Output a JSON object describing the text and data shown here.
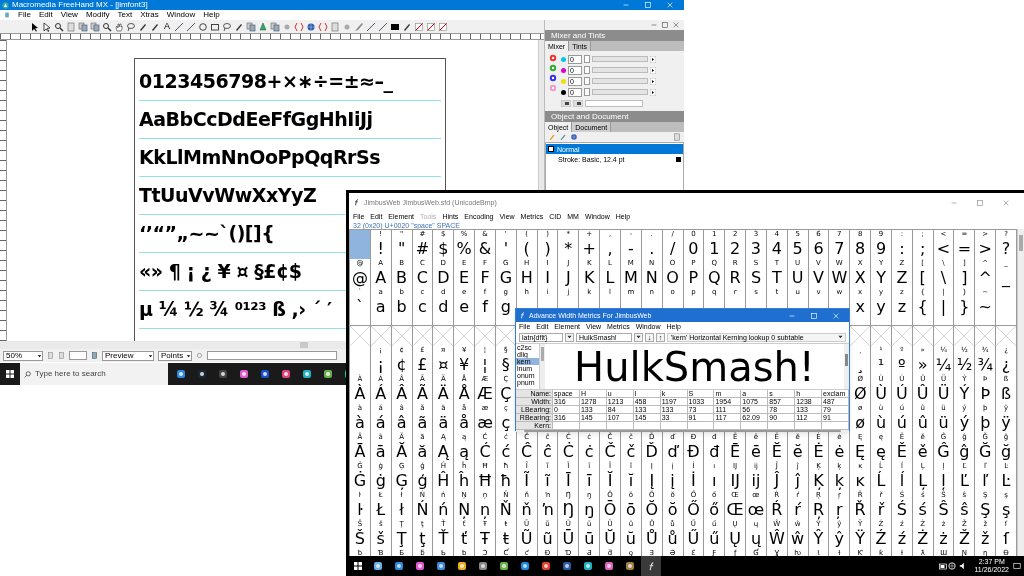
{
  "freehand": {
    "title": "Macromedia FreeHand MX - [jimfont3]",
    "menu": [
      "File",
      "Edit",
      "View",
      "Modify",
      "Text",
      "Xtras",
      "Window",
      "Help"
    ],
    "text_tool": "A",
    "paper_lines": [
      "0123456798+×∗÷=±≈–_",
      "AaBbCcDdEeFfGgHhIiJj",
      "KkLlMmNnOoPpQqRrSs",
      "TtUuVvWwXxYyZ",
      "‘’“”„~~`()[]{",
      "«» ¶ ¡ ¿ ¥ ¤ §£¢$",
      "µ ¼ ½ ¾ ⁰¹²³ ß ,› ´ ′"
    ],
    "mixer": {
      "title": "Mixer and Tints",
      "tabs": [
        {
          "label": "Mixer",
          "selected": true
        },
        {
          "label": "Tints",
          "selected": false
        }
      ],
      "channels": [
        {
          "color": "#00c8e8",
          "value": "0"
        },
        {
          "color": "#e000c8",
          "value": "0"
        },
        {
          "color": "#f0e000",
          "value": "0"
        },
        {
          "color": "#000000",
          "value": "0"
        }
      ]
    },
    "object_panel": {
      "title": "Object and Document",
      "tabs": [
        {
          "label": "Object",
          "selected": true
        },
        {
          "label": "Document",
          "selected": false
        }
      ],
      "items": [
        {
          "label": "Normal",
          "selected": true
        },
        {
          "label": "Stroke: Basic, 12.4 pt",
          "selected": false
        }
      ]
    },
    "status": {
      "zoom": "50%",
      "view": "Preview",
      "units": "Points"
    },
    "taskbar": {
      "search_placeholder": "Type here to search"
    }
  },
  "fontforge": {
    "title": "JimbusWeb JimbusWeb.sfd (UnicodeBmp)",
    "menu": [
      {
        "label": "File",
        "disabled": false
      },
      {
        "label": "Edit",
        "disabled": false
      },
      {
        "label": "Element",
        "disabled": false
      },
      {
        "label": "Tools",
        "disabled": true
      },
      {
        "label": "Hints",
        "disabled": false
      },
      {
        "label": "Encoding",
        "disabled": false
      },
      {
        "label": "View",
        "disabled": false
      },
      {
        "label": "Metrics",
        "disabled": false
      },
      {
        "label": "CID",
        "disabled": false
      },
      {
        "label": "MM",
        "disabled": false
      },
      {
        "label": "Window",
        "disabled": false
      },
      {
        "label": "Help",
        "disabled": false
      }
    ],
    "info": "32 (0x20) U+0020 \"space\" SPACE",
    "rows": [
      {
        "cells": [
          {
            "selected": true
          },
          {
            "label": "!",
            "glyph": "!",
            "selected": false
          },
          {
            "label": "\"",
            "glyph": "\"",
            "selected": false
          },
          {
            "label": "#",
            "glyph": "#",
            "selected": false
          },
          {
            "label": "$",
            "glyph": "$",
            "selected": false
          },
          {
            "label": "%",
            "glyph": "%",
            "selected": false
          },
          {
            "label": "&",
            "glyph": "&",
            "selected": false
          },
          {
            "label": "'",
            "glyph": "'",
            "selected": false
          },
          {
            "label": "(",
            "glyph": "(",
            "selected": false
          },
          {
            "label": ")",
            "glyph": ")",
            "selected": false
          },
          {
            "label": "*",
            "glyph": "*",
            "selected": false
          },
          {
            "label": "+",
            "glyph": "+",
            "selected": false
          },
          {
            "label": ",",
            "glyph": ",",
            "selected": false
          },
          {
            "label": "-",
            "glyph": "-",
            "selected": false
          },
          {
            "label": ".",
            "glyph": ".",
            "selected": false
          },
          {
            "label": "/",
            "glyph": "/",
            "selected": false
          },
          {
            "label": "0",
            "glyph": "0",
            "selected": false
          },
          {
            "label": "1",
            "glyph": "1",
            "selected": false
          },
          {
            "label": "2",
            "glyph": "2",
            "selected": false
          },
          {
            "label": "3",
            "glyph": "3",
            "selected": false
          },
          {
            "label": "4",
            "glyph": "4",
            "selected": false
          },
          {
            "label": "5",
            "glyph": "5",
            "selected": false
          },
          {
            "label": "6",
            "glyph": "6",
            "selected": false
          },
          {
            "label": "7",
            "glyph": "7",
            "selected": false
          },
          {
            "label": "8",
            "glyph": "8",
            "selected": false
          },
          {
            "label": "9",
            "glyph": "9",
            "selected": false
          },
          {
            "label": ":",
            "glyph": ":",
            "selected": false
          },
          {
            "label": ";",
            "glyph": ";",
            "selected": false
          },
          {
            "label": "<",
            "glyph": "<",
            "selected": false
          },
          {
            "label": "=",
            "glyph": "=",
            "selected": false
          },
          {
            "label": ">",
            "glyph": ">",
            "selected": false
          },
          {
            "label": "?",
            "glyph": "?",
            "selected": false
          }
        ]
      },
      {
        "cells": [
          {
            "label": "@",
            "glyph": "@",
            "selected": false
          },
          {
            "label": "A",
            "glyph": "A",
            "selected": false
          },
          {
            "label": "B",
            "glyph": "B",
            "selected": false
          },
          {
            "label": "C",
            "glyph": "C",
            "selected": false
          },
          {
            "label": "D",
            "glyph": "D",
            "selected": false
          },
          {
            "label": "E",
            "glyph": "E",
            "selected": false
          },
          {
            "label": "F",
            "glyph": "F",
            "selected": false
          },
          {
            "label": "G",
            "glyph": "G",
            "selected": false
          },
          {
            "label": "H",
            "glyph": "H",
            "selected": false
          },
          {
            "label": "I",
            "glyph": "I",
            "selected": false
          },
          {
            "label": "J",
            "glyph": "J",
            "selected": false
          },
          {
            "label": "K",
            "glyph": "K",
            "selected": false
          },
          {
            "label": "L",
            "glyph": "L",
            "selected": false
          },
          {
            "label": "M",
            "glyph": "M",
            "selected": false
          },
          {
            "label": "N",
            "glyph": "N",
            "selected": false
          },
          {
            "label": "O",
            "glyph": "O",
            "selected": false
          },
          {
            "label": "P",
            "glyph": "P",
            "selected": false
          },
          {
            "label": "Q",
            "glyph": "Q",
            "selected": false
          },
          {
            "label": "R",
            "glyph": "R",
            "selected": false
          },
          {
            "label": "S",
            "glyph": "S",
            "selected": false
          },
          {
            "label": "T",
            "glyph": "T",
            "selected": false
          },
          {
            "label": "U",
            "glyph": "U",
            "selected": false
          },
          {
            "label": "V",
            "glyph": "V",
            "selected": false
          },
          {
            "label": "W",
            "glyph": "W",
            "selected": false
          },
          {
            "label": "X",
            "glyph": "X",
            "selected": false
          },
          {
            "label": "Y",
            "glyph": "Y",
            "selected": false
          },
          {
            "label": "Z",
            "glyph": "Z",
            "selected": false
          },
          {
            "label": "[",
            "glyph": "[",
            "selected": false
          },
          {
            "label": "\\",
            "glyph": "\\",
            "selected": false
          },
          {
            "label": "]",
            "glyph": "]",
            "selected": false
          },
          {
            "label": "^",
            "glyph": "^",
            "selected": false
          },
          {
            "label": "_",
            "glyph": "_",
            "selected": false
          }
        ]
      },
      {
        "cells": [
          {
            "label": "`",
            "glyph": "`",
            "selected": false
          },
          {
            "label": "a",
            "glyph": "a",
            "selected": false
          },
          {
            "label": "b",
            "glyph": "b",
            "selected": false
          },
          {
            "label": "c",
            "glyph": "c",
            "selected": false
          },
          {
            "label": "d",
            "glyph": "d",
            "selected": false
          },
          {
            "label": "e",
            "glyph": "e",
            "selected": false
          },
          {
            "label": "f",
            "glyph": "f",
            "selected": false
          },
          {
            "label": "g",
            "glyph": "g",
            "selected": false
          },
          {
            "label": "h",
            "selected": false
          },
          {
            "label": "i",
            "selected": false
          },
          {
            "label": "j",
            "selected": false
          },
          {
            "label": "k",
            "selected": false
          },
          {
            "label": "l",
            "selected": false
          },
          {
            "label": "m",
            "selected": false
          },
          {
            "label": "n",
            "selected": false
          },
          {
            "label": "o",
            "selected": false
          },
          {
            "label": "p",
            "selected": false
          },
          {
            "label": "q",
            "selected": false
          },
          {
            "label": "r",
            "selected": false
          },
          {
            "label": "s",
            "selected": false
          },
          {
            "label": "t",
            "selected": false
          },
          {
            "label": "u",
            "selected": false
          },
          {
            "label": "v",
            "selected": false
          },
          {
            "label": "w",
            "selected": false
          },
          {
            "label": "x",
            "glyph": "x",
            "selected": false
          },
          {
            "label": "y",
            "glyph": "y",
            "selected": false
          },
          {
            "label": "z",
            "glyph": "z",
            "selected": false
          },
          {
            "label": "{",
            "glyph": "{",
            "selected": false
          },
          {
            "label": "|",
            "glyph": "|",
            "selected": false
          },
          {
            "label": "}",
            "glyph": "}",
            "selected": false
          },
          {
            "label": "~",
            "glyph": "~",
            "selected": false
          },
          {
            "selected": false
          }
        ]
      },
      {
        "kind": "empty",
        "cells": [
          {
            "selected": false
          },
          {
            "selected": false
          },
          {
            "selected": false
          },
          {
            "selected": false
          },
          {
            "selected": false
          },
          {
            "selected": false
          },
          {
            "selected": false
          },
          {
            "selected": false
          }
        ],
        "right_cells": [
          {
            "selected": false
          },
          {
            "selected": false
          },
          {
            "selected": false
          },
          {
            "selected": false
          },
          {
            "selected": false
          },
          {
            "selected": false
          },
          {
            "selected": false
          },
          {
            "selected": false
          }
        ]
      },
      {
        "cells": [
          {
            "selected": false
          },
          {
            "label": "¡",
            "glyph": "¡",
            "selected": false
          },
          {
            "label": "¢",
            "glyph": "¢",
            "selected": false
          },
          {
            "label": "£",
            "glyph": "£",
            "selected": false
          },
          {
            "label": "¤",
            "glyph": "¤",
            "selected": false
          },
          {
            "label": "¥",
            "glyph": "¥",
            "selected": false
          },
          {
            "label": "¦",
            "glyph": "¦",
            "selected": false
          },
          {
            "label": "§",
            "glyph": "§",
            "selected": false
          }
        ],
        "right_cells": [
          {
            "label": "¸",
            "glyph": "¸",
            "selected": false
          },
          {
            "label": "¹",
            "glyph": "¹",
            "selected": false
          },
          {
            "label": "º",
            "glyph": "º",
            "selected": false
          },
          {
            "label": "»",
            "glyph": "»",
            "selected": false
          },
          {
            "label": "¼",
            "glyph": "¼",
            "selected": false
          },
          {
            "label": "½",
            "glyph": "½",
            "selected": false
          },
          {
            "label": "¾",
            "glyph": "¾",
            "selected": false
          },
          {
            "label": "¿",
            "glyph": "¿",
            "selected": false
          }
        ]
      },
      {
        "cells": [
          {
            "label": "À",
            "glyph": "À",
            "selected": false
          },
          {
            "label": "Á",
            "glyph": "Á",
            "selected": false
          },
          {
            "label": "Â",
            "glyph": "Â",
            "selected": false
          },
          {
            "label": "Ã",
            "glyph": "Ã",
            "selected": false
          },
          {
            "label": "Ä",
            "glyph": "Ä",
            "selected": false
          },
          {
            "label": "Å",
            "glyph": "Å",
            "selected": false
          },
          {
            "label": "Æ",
            "glyph": "Æ",
            "selected": false
          },
          {
            "label": "Ç",
            "glyph": "Ç",
            "selected": false
          }
        ],
        "right_cells": [
          {
            "label": "Ø",
            "glyph": "Ø",
            "selected": false
          },
          {
            "label": "Ù",
            "glyph": "Ù",
            "selected": false
          },
          {
            "label": "Ú",
            "glyph": "Ú",
            "selected": false
          },
          {
            "label": "Û",
            "glyph": "Û",
            "selected": false
          },
          {
            "label": "Ü",
            "glyph": "Ü",
            "selected": false
          },
          {
            "label": "Ý",
            "glyph": "Ý",
            "selected": false
          },
          {
            "label": "Þ",
            "glyph": "Þ",
            "selected": false
          },
          {
            "label": "ß",
            "glyph": "ß",
            "selected": false
          }
        ]
      },
      {
        "cells": [
          {
            "label": "à",
            "glyph": "à",
            "selected": false
          },
          {
            "label": "á",
            "glyph": "á",
            "selected": false
          },
          {
            "label": "â",
            "glyph": "â",
            "selected": false
          },
          {
            "label": "ã",
            "glyph": "ã",
            "selected": false
          },
          {
            "label": "ä",
            "glyph": "ä",
            "selected": false
          },
          {
            "label": "å",
            "glyph": "å",
            "selected": false
          },
          {
            "label": "æ",
            "glyph": "æ",
            "selected": false
          },
          {
            "label": "ç",
            "glyph": "ç",
            "selected": false
          }
        ],
        "right_cells": [
          {
            "label": "ø",
            "glyph": "ø",
            "selected": false
          },
          {
            "label": "ù",
            "glyph": "ù",
            "selected": false
          },
          {
            "label": "ú",
            "glyph": "ú",
            "selected": false
          },
          {
            "label": "û",
            "glyph": "û",
            "selected": false
          },
          {
            "label": "ü",
            "glyph": "ü",
            "selected": false
          },
          {
            "label": "ý",
            "glyph": "ý",
            "selected": false
          },
          {
            "label": "þ",
            "glyph": "þ",
            "selected": false
          },
          {
            "label": "ÿ",
            "glyph": "ÿ",
            "selected": false
          }
        ]
      },
      {
        "cells": [
          {
            "label": "Ā",
            "glyph": "Ā",
            "selected": false
          },
          {
            "label": "ā",
            "glyph": "ā",
            "selected": false
          },
          {
            "label": "Ă",
            "glyph": "Ă",
            "selected": false
          },
          {
            "label": "ă",
            "glyph": "ă",
            "selected": false
          },
          {
            "label": "Ą",
            "glyph": "Ą",
            "selected": false
          },
          {
            "label": "ą",
            "glyph": "ą",
            "selected": false
          },
          {
            "label": "Ć",
            "glyph": "Ć",
            "selected": false
          },
          {
            "label": "ć",
            "glyph": "ć",
            "selected": false
          },
          {
            "label": "Ĉ",
            "glyph": "Ĉ",
            "selected": false
          },
          {
            "label": "ĉ",
            "glyph": "ĉ",
            "selected": false
          },
          {
            "label": "Ċ",
            "glyph": "Ċ",
            "selected": false
          },
          {
            "label": "ċ",
            "glyph": "ċ",
            "selected": false
          },
          {
            "label": "Č",
            "glyph": "Č",
            "selected": false
          },
          {
            "label": "č",
            "glyph": "č",
            "selected": false
          },
          {
            "label": "Ď",
            "glyph": "Ď",
            "selected": false
          },
          {
            "label": "ď",
            "glyph": "ď",
            "selected": false
          },
          {
            "label": "Đ",
            "glyph": "Đ",
            "selected": false
          },
          {
            "label": "đ",
            "glyph": "đ",
            "selected": false
          },
          {
            "label": "Ē",
            "glyph": "Ē",
            "selected": false
          },
          {
            "label": "ē",
            "glyph": "ē",
            "selected": false
          },
          {
            "label": "Ĕ",
            "glyph": "Ĕ",
            "selected": false
          },
          {
            "label": "ĕ",
            "glyph": "ĕ",
            "selected": false
          },
          {
            "label": "Ė",
            "glyph": "Ė",
            "selected": false
          },
          {
            "label": "ė",
            "glyph": "ė",
            "selected": false
          },
          {
            "label": "Ę",
            "glyph": "Ę",
            "selected": false
          },
          {
            "label": "ę",
            "glyph": "ę",
            "selected": false
          },
          {
            "label": "Ě",
            "glyph": "Ě",
            "selected": false
          },
          {
            "label": "ě",
            "glyph": "ě",
            "selected": false
          },
          {
            "label": "Ĝ",
            "glyph": "Ĝ",
            "selected": false
          },
          {
            "label": "ĝ",
            "glyph": "ĝ",
            "selected": false
          },
          {
            "label": "Ğ",
            "glyph": "Ğ",
            "selected": false
          },
          {
            "label": "ğ",
            "glyph": "ğ",
            "selected": false
          }
        ]
      },
      {
        "cells": [
          {
            "label": "Ġ",
            "glyph": "Ġ",
            "selected": false
          },
          {
            "label": "ġ",
            "glyph": "ġ",
            "selected": false
          },
          {
            "label": "Ģ",
            "glyph": "Ģ",
            "selected": false
          },
          {
            "label": "ģ",
            "glyph": "ģ",
            "selected": false
          },
          {
            "label": "Ĥ",
            "glyph": "Ĥ",
            "selected": false
          },
          {
            "label": "ĥ",
            "glyph": "ĥ",
            "selected": false
          },
          {
            "label": "Ħ",
            "glyph": "Ħ",
            "selected": false
          },
          {
            "label": "ħ",
            "glyph": "ħ",
            "selected": false
          },
          {
            "label": "Ĩ",
            "glyph": "Ĩ",
            "selected": false
          },
          {
            "label": "ĩ",
            "glyph": "ĩ",
            "selected": false
          },
          {
            "label": "Ī",
            "glyph": "Ī",
            "selected": false
          },
          {
            "label": "ī",
            "glyph": "ī",
            "selected": false
          },
          {
            "label": "Ĭ",
            "glyph": "Ĭ",
            "selected": false
          },
          {
            "label": "ĭ",
            "glyph": "ĭ",
            "selected": false
          },
          {
            "label": "Į",
            "glyph": "Į",
            "selected": false
          },
          {
            "label": "į",
            "glyph": "į",
            "selected": false
          },
          {
            "label": "İ",
            "glyph": "İ",
            "selected": false
          },
          {
            "label": "ı",
            "glyph": "ı",
            "selected": false
          },
          {
            "label": "Ĳ",
            "glyph": "Ĳ",
            "selected": false
          },
          {
            "label": "ĳ",
            "glyph": "ĳ",
            "selected": false
          },
          {
            "label": "Ĵ",
            "glyph": "Ĵ",
            "selected": false
          },
          {
            "label": "ĵ",
            "glyph": "ĵ",
            "selected": false
          },
          {
            "label": "Ķ",
            "glyph": "Ķ",
            "selected": false
          },
          {
            "label": "ķ",
            "glyph": "ķ",
            "selected": false
          },
          {
            "label": "ĸ",
            "glyph": "ĸ",
            "selected": false
          },
          {
            "label": "Ĺ",
            "glyph": "Ĺ",
            "selected": false
          },
          {
            "label": "ĺ",
            "glyph": "ĺ",
            "selected": false
          },
          {
            "label": "Ļ",
            "glyph": "Ļ",
            "selected": false
          },
          {
            "label": "ļ",
            "glyph": "ļ",
            "selected": false
          },
          {
            "label": "Ľ",
            "glyph": "Ľ",
            "selected": false
          },
          {
            "label": "ľ",
            "glyph": "ľ",
            "selected": false
          },
          {
            "label": "Ŀ",
            "glyph": "Ŀ",
            "selected": false
          }
        ]
      },
      {
        "cells": [
          {
            "label": "ŀ",
            "glyph": "ŀ",
            "selected": false
          },
          {
            "label": "Ł",
            "glyph": "Ł",
            "selected": false
          },
          {
            "label": "ł",
            "glyph": "ł",
            "selected": false
          },
          {
            "label": "Ń",
            "glyph": "Ń",
            "selected": false
          },
          {
            "label": "ń",
            "glyph": "ń",
            "selected": false
          },
          {
            "label": "Ņ",
            "glyph": "Ņ",
            "selected": false
          },
          {
            "label": "ņ",
            "glyph": "ņ",
            "selected": false
          },
          {
            "label": "Ň",
            "glyph": "Ň",
            "selected": false
          },
          {
            "label": "ň",
            "glyph": "ň",
            "selected": false
          },
          {
            "label": "ŉ",
            "glyph": "ŉ",
            "selected": false
          },
          {
            "label": "Ŋ",
            "glyph": "Ŋ",
            "selected": false
          },
          {
            "label": "ŋ",
            "glyph": "ŋ",
            "selected": false
          },
          {
            "label": "Ō",
            "glyph": "Ō",
            "selected": false
          },
          {
            "label": "ō",
            "glyph": "ō",
            "selected": false
          },
          {
            "label": "Ŏ",
            "glyph": "Ŏ",
            "selected": false
          },
          {
            "label": "ŏ",
            "glyph": "ŏ",
            "selected": false
          },
          {
            "label": "Ő",
            "glyph": "Ő",
            "selected": false
          },
          {
            "label": "ő",
            "glyph": "ő",
            "selected": false
          },
          {
            "label": "Œ",
            "glyph": "Œ",
            "selected": false
          },
          {
            "label": "œ",
            "glyph": "œ",
            "selected": false
          },
          {
            "label": "Ŕ",
            "glyph": "Ŕ",
            "selected": false
          },
          {
            "label": "ŕ",
            "glyph": "ŕ",
            "selected": false
          },
          {
            "label": "Ŗ",
            "glyph": "Ŗ",
            "selected": false
          },
          {
            "label": "ŗ",
            "glyph": "ŗ",
            "selected": false
          },
          {
            "label": "Ř",
            "glyph": "Ř",
            "selected": false
          },
          {
            "label": "ř",
            "glyph": "ř",
            "selected": false
          },
          {
            "label": "Ś",
            "glyph": "Ś",
            "selected": false
          },
          {
            "label": "ś",
            "glyph": "ś",
            "selected": false
          },
          {
            "label": "Ŝ",
            "glyph": "Ŝ",
            "selected": false
          },
          {
            "label": "ŝ",
            "glyph": "ŝ",
            "selected": false
          },
          {
            "label": "Ş",
            "glyph": "Ş",
            "selected": false
          },
          {
            "label": "ş",
            "glyph": "ş",
            "selected": false
          }
        ]
      },
      {
        "cells": [
          {
            "label": "Š",
            "glyph": "Š",
            "selected": false
          },
          {
            "label": "š",
            "glyph": "š",
            "selected": false
          },
          {
            "label": "Ţ",
            "glyph": "Ţ",
            "selected": false
          },
          {
            "label": "ţ",
            "glyph": "ţ",
            "selected": false
          },
          {
            "label": "Ť",
            "glyph": "Ť",
            "selected": false
          },
          {
            "label": "ť",
            "glyph": "ť",
            "selected": false
          },
          {
            "label": "Ŧ",
            "glyph": "Ŧ",
            "selected": false
          },
          {
            "label": "ŧ",
            "glyph": "ŧ",
            "selected": false
          },
          {
            "label": "Ũ",
            "glyph": "Ũ",
            "selected": false
          },
          {
            "label": "ũ",
            "glyph": "ũ",
            "selected": false
          },
          {
            "label": "Ū",
            "glyph": "Ū",
            "selected": false
          },
          {
            "label": "ū",
            "glyph": "ū",
            "selected": false
          },
          {
            "label": "Ŭ",
            "glyph": "Ŭ",
            "selected": false
          },
          {
            "label": "ŭ",
            "glyph": "ŭ",
            "selected": false
          },
          {
            "label": "Ů",
            "glyph": "Ů",
            "selected": false
          },
          {
            "label": "ů",
            "glyph": "ů",
            "selected": false
          },
          {
            "label": "Ű",
            "glyph": "Ű",
            "selected": false
          },
          {
            "label": "ű",
            "glyph": "ű",
            "selected": false
          },
          {
            "label": "Ų",
            "glyph": "Ų",
            "selected": false
          },
          {
            "label": "ų",
            "glyph": "ų",
            "selected": false
          },
          {
            "label": "Ŵ",
            "glyph": "Ŵ",
            "selected": false
          },
          {
            "label": "ŵ",
            "glyph": "ŵ",
            "selected": false
          },
          {
            "label": "Ŷ",
            "glyph": "Ŷ",
            "selected": false
          },
          {
            "label": "ŷ",
            "glyph": "ŷ",
            "selected": false
          },
          {
            "label": "Ÿ",
            "glyph": "Ÿ",
            "selected": false
          },
          {
            "label": "Ź",
            "glyph": "Ź",
            "selected": false
          },
          {
            "label": "ź",
            "glyph": "ź",
            "selected": false
          },
          {
            "label": "Ż",
            "glyph": "Ż",
            "selected": false
          },
          {
            "label": "ż",
            "glyph": "ż",
            "selected": false
          },
          {
            "label": "Ž",
            "glyph": "Ž",
            "selected": false
          },
          {
            "label": "ž",
            "glyph": "ž",
            "selected": false
          },
          {
            "label": "ſ",
            "glyph": "ſ",
            "selected": false
          }
        ]
      },
      {
        "cells": [
          {
            "label": "ƀ",
            "selected": false
          },
          {
            "label": "Ɓ",
            "selected": false
          },
          {
            "label": "Ƃ",
            "selected": false
          },
          {
            "label": "ƃ",
            "selected": false
          },
          {
            "label": "Ƅ",
            "selected": false
          },
          {
            "label": "ƅ",
            "selected": false
          },
          {
            "label": "Ɔ",
            "selected": false
          },
          {
            "label": "Ƈ",
            "selected": false
          },
          {
            "label": "ƈ",
            "selected": false
          },
          {
            "label": "Ɖ",
            "selected": false
          },
          {
            "label": "Ɗ",
            "selected": false
          },
          {
            "label": "Ƌ",
            "selected": false
          },
          {
            "label": "ƌ",
            "selected": false
          },
          {
            "label": "ƍ",
            "selected": false
          },
          {
            "label": "Ǝ",
            "selected": false
          },
          {
            "label": "Ə",
            "selected": false
          },
          {
            "label": "Ɛ",
            "selected": false
          },
          {
            "label": "Ƒ",
            "selected": false
          },
          {
            "label": "ƒ",
            "selected": false
          },
          {
            "label": "Ɠ",
            "selected": false
          },
          {
            "label": "Ɣ",
            "selected": false
          },
          {
            "label": "ƕ",
            "selected": false
          },
          {
            "label": "Ɩ",
            "selected": false
          },
          {
            "label": "Ɨ",
            "selected": false
          },
          {
            "label": "Ƙ",
            "selected": false
          },
          {
            "label": "ƙ",
            "selected": false
          },
          {
            "label": "ƚ",
            "selected": false
          },
          {
            "label": "ƛ",
            "selected": false
          },
          {
            "label": "Ɯ",
            "selected": false
          },
          {
            "label": "Ɲ",
            "selected": false
          },
          {
            "label": "ƞ",
            "selected": false
          },
          {
            "label": "Ɵ",
            "selected": false
          }
        ]
      }
    ],
    "metrics_window": {
      "title": "Advance Width Metrics For JimbusWeb",
      "menu": [
        "File",
        "Edit",
        "Element",
        "View",
        "Metrics",
        "Window",
        "Help"
      ],
      "script": "latn{dflt}",
      "sample_text": "HulkSmash!",
      "arrows": [
        "↓",
        "↑"
      ],
      "lookup": "'kern' Horizontal Kerning lookup 0 subtable",
      "features": [
        {
          "label": "c2sc",
          "selected": false
        },
        {
          "label": "dlig",
          "selected": false
        },
        {
          "label": "kern",
          "selected": true
        },
        {
          "label": "lnum",
          "selected": false
        },
        {
          "label": "onum",
          "selected": false
        },
        {
          "label": "pnum",
          "selected": false
        }
      ],
      "preview": "HulkSmash!",
      "table": [
        {
          "label": "Name:",
          "cells": [
            "space",
            "H",
            "u",
            "l",
            "k",
            "S",
            "m",
            "a",
            "s",
            "h",
            "exclam"
          ]
        },
        {
          "label": "Width:",
          "cells": [
            "316",
            "1278",
            "1213",
            "458",
            "1197",
            "1033",
            "1954",
            "1075",
            "857",
            "1238",
            "487"
          ]
        },
        {
          "label": "LBearing:",
          "cells": [
            "0",
            "133",
            "84",
            "133",
            "133",
            "73",
            "111",
            "56",
            "78",
            "133",
            "79"
          ]
        },
        {
          "label": "RBearing:",
          "cells": [
            "316",
            "145",
            "107",
            "145",
            "33",
            "91",
            "117",
            "62.09",
            "90",
            "112",
            "91"
          ]
        },
        {
          "label": "Kern:"
        }
      ]
    },
    "taskbar": {
      "time": "2:37 PM",
      "date": "11/26/2022"
    }
  }
}
